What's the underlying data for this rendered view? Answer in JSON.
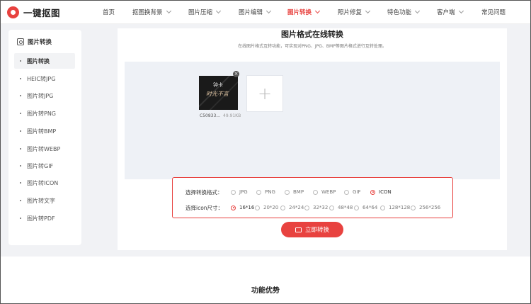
{
  "brand": {
    "name": "一键抠图"
  },
  "nav": [
    {
      "label": "首页",
      "has_menu": false
    },
    {
      "label": "抠图换背景",
      "has_menu": true
    },
    {
      "label": "图片压缩",
      "has_menu": true
    },
    {
      "label": "图片编辑",
      "has_menu": true
    },
    {
      "label": "图片转换",
      "has_menu": true,
      "active": true
    },
    {
      "label": "照片修复",
      "has_menu": true
    },
    {
      "label": "特色功能",
      "has_menu": true
    },
    {
      "label": "客户端",
      "has_menu": true
    },
    {
      "label": "常见问题",
      "has_menu": false
    }
  ],
  "sidebar": {
    "title": "图片转换",
    "items": [
      {
        "label": "图片转换",
        "active": true
      },
      {
        "label": "HEIC转JPG"
      },
      {
        "label": "图片转JPG"
      },
      {
        "label": "图片转PNG"
      },
      {
        "label": "图片转BMP"
      },
      {
        "label": "图片转WEBP"
      },
      {
        "label": "图片转GIF"
      },
      {
        "label": "图片转ICON"
      },
      {
        "label": "图片转文字"
      },
      {
        "label": "图片转PDF"
      }
    ]
  },
  "main": {
    "title": "图片格式在线转换",
    "subtitle": "在线图片格式互转功能，可实现对PNG、JPG、BMP等图片格式进行互转处理。",
    "file": {
      "name": "C5083​3...",
      "size": "49.91KB",
      "thumb_text_1": "钟卡",
      "thumb_text_2": "时光不言"
    },
    "add_symbol": "+",
    "format_label": "选择转换格式：",
    "formats": [
      {
        "label": "JPG"
      },
      {
        "label": "PNG"
      },
      {
        "label": "BMP"
      },
      {
        "label": "WEBP"
      },
      {
        "label": "GIF"
      },
      {
        "label": "ICON",
        "checked": true
      }
    ],
    "size_label": "选择icon尺寸：",
    "sizes": [
      {
        "label": "16*16",
        "checked": true
      },
      {
        "label": "20*20"
      },
      {
        "label": "24*24"
      },
      {
        "label": "32*32"
      },
      {
        "label": "48*48"
      },
      {
        "label": "64*64"
      },
      {
        "label": "128*128"
      },
      {
        "label": "256*256"
      }
    ],
    "convert_label": "立即转换"
  },
  "section": {
    "title": "功能优势"
  },
  "colors": {
    "accent": "#e8423f",
    "upload_bg": "#eef1f6",
    "page_bg": "#f1f2f5"
  }
}
